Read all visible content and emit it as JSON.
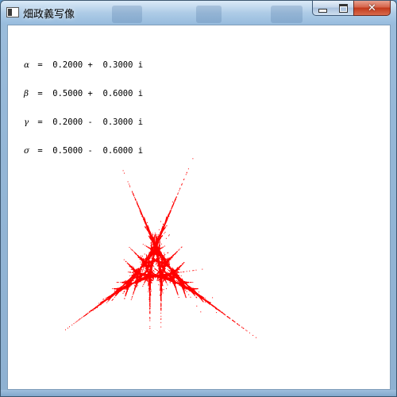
{
  "window": {
    "title": "畑政義写像",
    "min_label": "",
    "max_label": "",
    "close_label": "✕"
  },
  "parameters": [
    {
      "symbol": "α",
      "text": " =  0.2000 +  0.3000 i"
    },
    {
      "symbol": "β",
      "text": " =  0.5000 +  0.6000 i"
    },
    {
      "symbol": "γ",
      "text": " =  0.2000 -  0.3000 i"
    },
    {
      "symbol": "σ",
      "text": " =  0.5000 -  0.6000 i"
    }
  ],
  "colors": {
    "fractal": "#ff0000",
    "canvas_background": "#ffffff",
    "close_button": "#c2391b"
  },
  "icons": {
    "app": "window-app-icon",
    "minimize": "minimize-icon",
    "maximize": "maximize-icon",
    "close": "close-icon"
  }
}
